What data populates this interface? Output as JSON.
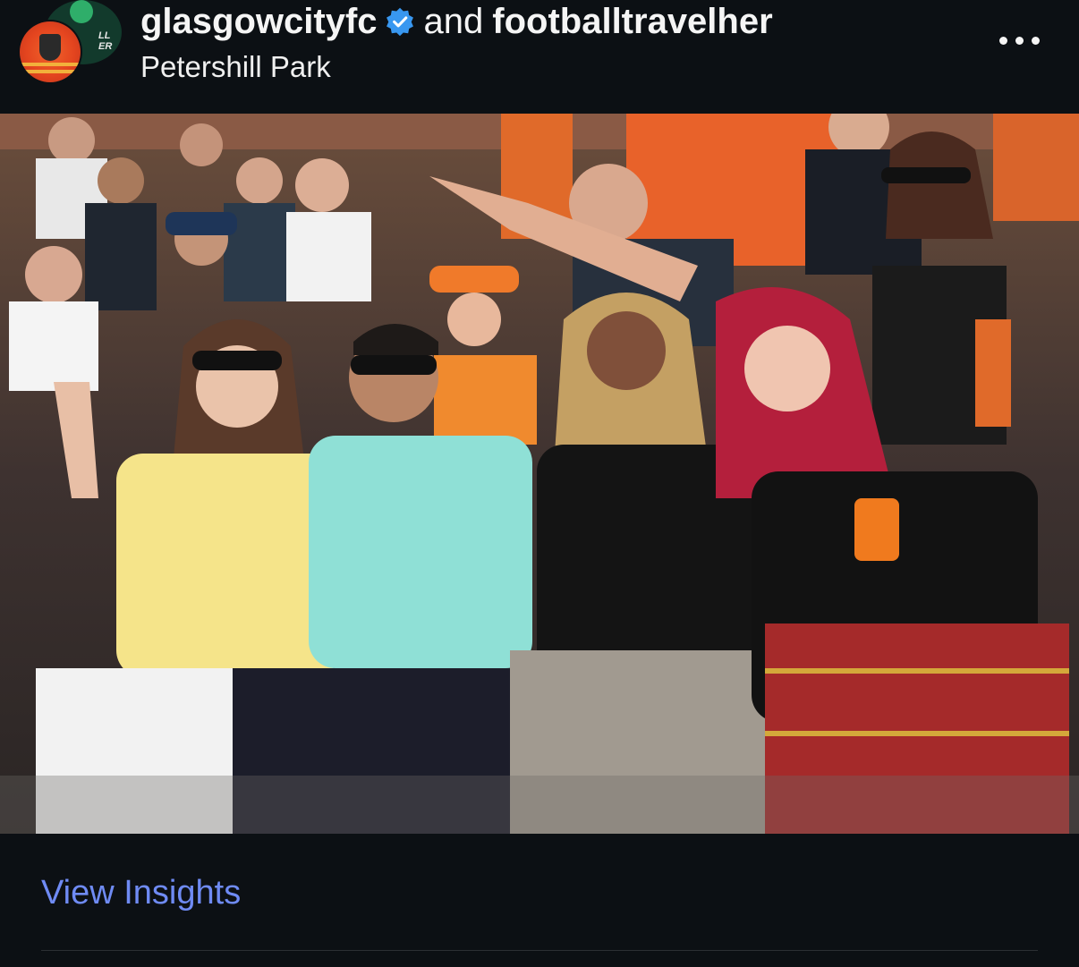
{
  "post": {
    "author_primary": "glasgowcityfc",
    "conjunction": "and",
    "author_secondary": "footballtravelher",
    "location": "Petershill Park",
    "more_icon": "more-horizontal-icon",
    "verified_icon": "verified-badge-icon"
  },
  "photo": {
    "tag_icon": "person-icon"
  },
  "footer": {
    "insights_label": "View Insights"
  },
  "colors": {
    "background": "#0c1014",
    "link": "#6f8bf4",
    "verified": "#3897f0",
    "text": "#f5f5f5"
  }
}
